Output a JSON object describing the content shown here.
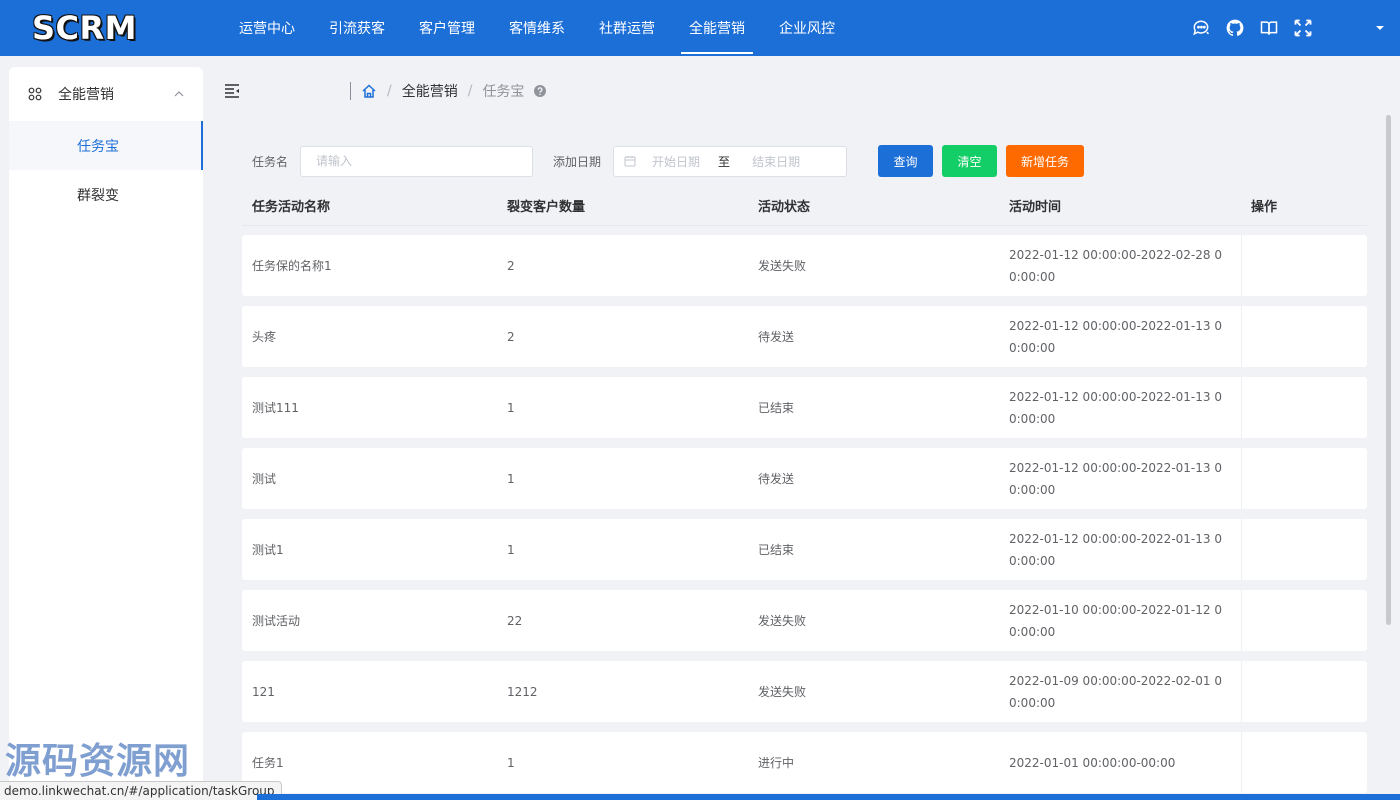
{
  "brand": {
    "logo_text": "SCRM"
  },
  "topnav": [
    {
      "label": "运营中心",
      "active": false
    },
    {
      "label": "引流获客",
      "active": false
    },
    {
      "label": "客户管理",
      "active": false
    },
    {
      "label": "客情维系",
      "active": false
    },
    {
      "label": "社群运营",
      "active": false
    },
    {
      "label": "全能营销",
      "active": true
    },
    {
      "label": "企业风控",
      "active": false
    }
  ],
  "header_icons": [
    "chat-icon",
    "github-icon",
    "book-icon",
    "fullscreen-icon",
    "chevron-down-icon"
  ],
  "sidebar": {
    "group_label": "全能营销",
    "items": [
      {
        "label": "任务宝",
        "active": true
      },
      {
        "label": "群裂变",
        "active": false
      }
    ]
  },
  "breadcrumb": {
    "items": [
      "全能营销",
      "任务宝"
    ]
  },
  "form": {
    "task_name_label": "任务名",
    "task_name_placeholder": "请输入",
    "date_label": "添加日期",
    "start_placeholder": "开始日期",
    "range_separator": "至",
    "end_placeholder": "结束日期",
    "query_button": "查询",
    "clear_button": "清空",
    "add_button": "新增任务"
  },
  "colors": {
    "primary": "#1d6fd8",
    "success": "#13ce66",
    "warning": "#ff6a00"
  },
  "table": {
    "columns": [
      "任务活动名称",
      "裂变客户数量",
      "活动状态",
      "活动时间",
      "操作"
    ],
    "rows": [
      {
        "name": "任务保的名称1",
        "count": "2",
        "status": "发送失败",
        "time": "2022-01-12 00:00:00-2022-02-28 00:00:00"
      },
      {
        "name": "头疼",
        "count": "2",
        "status": "待发送",
        "time": "2022-01-12 00:00:00-2022-01-13 00:00:00"
      },
      {
        "name": "测试111",
        "count": "1",
        "status": "已结束",
        "time": "2022-01-12 00:00:00-2022-01-13 00:00:00"
      },
      {
        "name": "测试",
        "count": "1",
        "status": "待发送",
        "time": "2022-01-12 00:00:00-2022-01-13 00:00:00"
      },
      {
        "name": "测试1",
        "count": "1",
        "status": "已结束",
        "time": "2022-01-12 00:00:00-2022-01-13 00:00:00"
      },
      {
        "name": "测试活动",
        "count": "22",
        "status": "发送失败",
        "time": "2022-01-10 00:00:00-2022-01-12 00:00:00"
      },
      {
        "name": "121",
        "count": "1212",
        "status": "发送失败",
        "time": "2022-01-09 00:00:00-2022-02-01 00:00:00"
      },
      {
        "name": "任务1",
        "count": "1",
        "status": "进行中",
        "time": "2022-01-01 00:00:00-00:00"
      }
    ]
  },
  "watermark": "源码资源网",
  "status_url": "demo.linkwechat.cn/#/application/taskGroup"
}
